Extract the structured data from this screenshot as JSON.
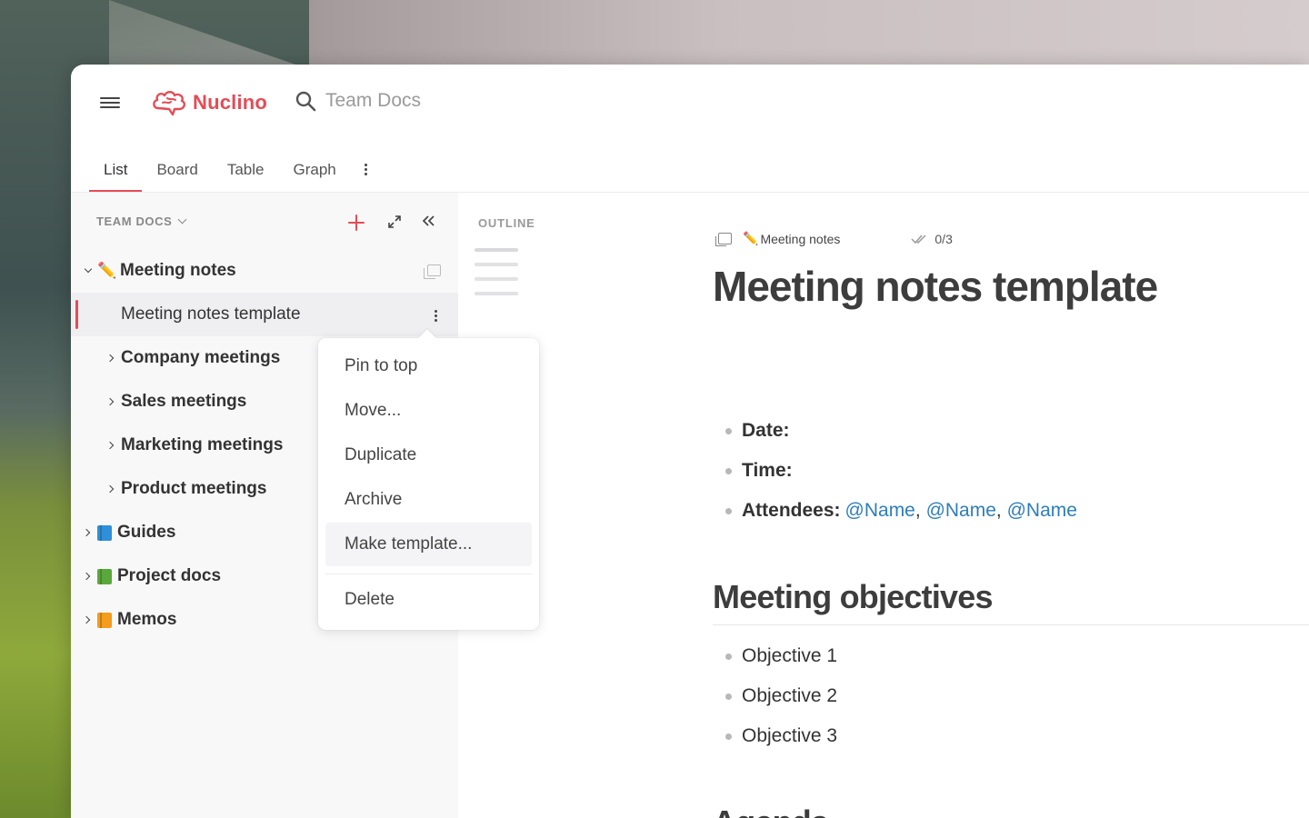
{
  "app": {
    "logo_text": "Nuclino",
    "brand_color": "#e64b55",
    "search_placeholder": "Team Docs"
  },
  "tabs": [
    {
      "label": "List",
      "active": true
    },
    {
      "label": "Board",
      "active": false
    },
    {
      "label": "Table",
      "active": false
    },
    {
      "label": "Graph",
      "active": false
    }
  ],
  "sidebar": {
    "header": "TEAM DOCS",
    "items": [
      {
        "label": "Meeting notes",
        "emoji": "✏️",
        "expanded": true,
        "bold": true
      },
      {
        "label": "Meeting notes template",
        "selected": true
      },
      {
        "label": "Company meetings",
        "bold": true
      },
      {
        "label": "Sales meetings",
        "bold": true
      },
      {
        "label": "Marketing meetings",
        "bold": true
      },
      {
        "label": "Product meetings",
        "bold": true
      },
      {
        "label": "Guides",
        "book_color": "#2f8fd8",
        "bold": true
      },
      {
        "label": "Project docs",
        "book_color": "#5aa83c",
        "bold": true
      },
      {
        "label": "Memos",
        "book_color": "#f39c1e",
        "bold": true
      }
    ]
  },
  "outline": {
    "title": "OUTLINE"
  },
  "context_menu": {
    "items": [
      "Pin to top",
      "Move...",
      "Duplicate",
      "Archive",
      "Make template...",
      "Delete"
    ],
    "hovered": "Make template..."
  },
  "document": {
    "breadcrumb_emoji": "✏️",
    "breadcrumb": "Meeting notes",
    "tasks": "0/3",
    "title": "Meeting notes template",
    "fields": {
      "date_label": "Date:",
      "time_label": "Time:",
      "attendees_label": "Attendees:",
      "mentions": [
        "@Name",
        "@Name",
        "@Name"
      ],
      "separator": ","
    },
    "objectives_heading": "Meeting objectives",
    "objectives": [
      "Objective 1",
      "Objective 2",
      "Objective 3"
    ],
    "agenda_heading": "Agenda"
  }
}
